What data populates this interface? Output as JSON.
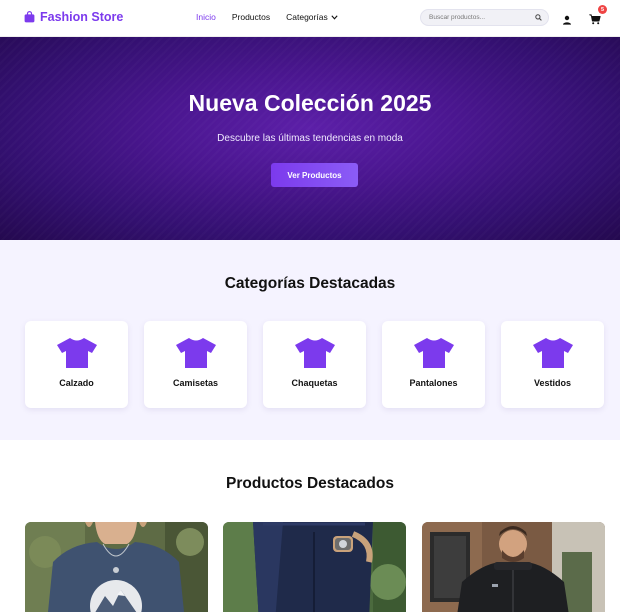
{
  "brand": {
    "name": "Fashion Store",
    "icon": "shopping-bag-icon"
  },
  "nav": {
    "links": [
      {
        "label": "Inicio",
        "active": true
      },
      {
        "label": "Productos",
        "active": false
      },
      {
        "label": "Categorías",
        "active": false,
        "dropdown": true
      }
    ]
  },
  "search": {
    "placeholder": "Buscar productos...",
    "value": ""
  },
  "cart": {
    "count": "5"
  },
  "hero": {
    "title": "Nueva Colección 2025",
    "subtitle": "Descubre las últimas tendencias en moda",
    "button_label": "Ver Productos"
  },
  "categories": {
    "title": "Categorías Destacadas",
    "items": [
      {
        "label": "Calzado",
        "icon": "tshirt-icon"
      },
      {
        "label": "Camisetas",
        "icon": "tshirt-icon"
      },
      {
        "label": "Chaquetas",
        "icon": "tshirt-icon"
      },
      {
        "label": "Pantalones",
        "icon": "tshirt-icon"
      },
      {
        "label": "Vestidos",
        "icon": "tshirt-icon"
      }
    ]
  },
  "products": {
    "title": "Productos Destacados"
  },
  "colors": {
    "accent": "#7c3aed",
    "hero_bg": "#4a168f",
    "badge": "#ef4444",
    "categories_bg": "#f5f3ff"
  }
}
